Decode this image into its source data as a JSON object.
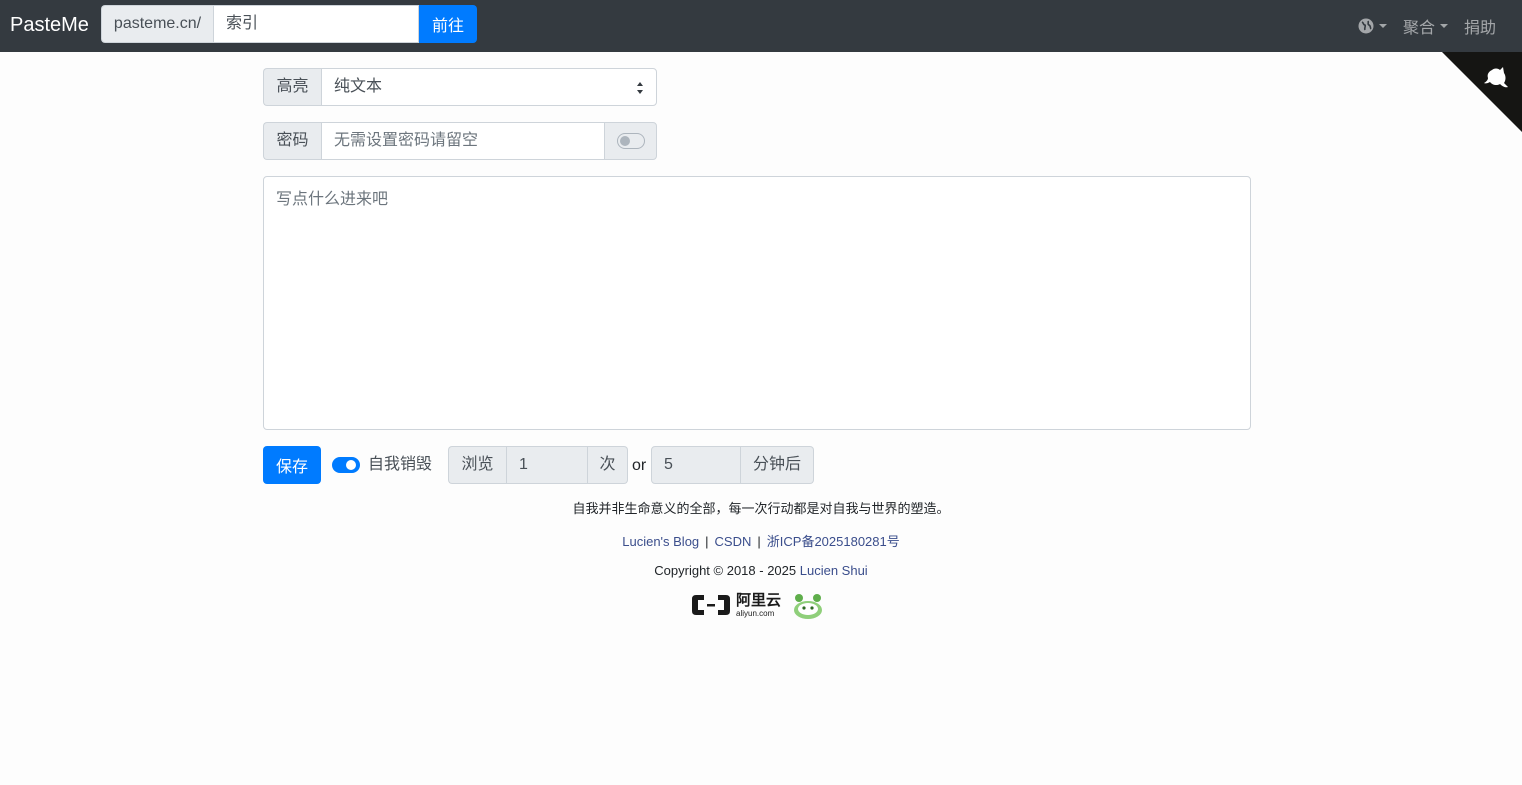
{
  "navbar": {
    "brand": "PasteMe",
    "index_prefix": "pasteme.cn/",
    "index_placeholder": "索引",
    "go_label": "前往",
    "right_items": [
      {
        "icon": "globe-icon",
        "label": ""
      },
      {
        "label": "聚合"
      },
      {
        "label": "捐助"
      }
    ]
  },
  "form": {
    "highlight_label": "高亮",
    "highlight_value": "纯文本",
    "password_label": "密码",
    "password_placeholder": "无需设置密码请留空",
    "password_toggle_on": false,
    "content_placeholder": "写点什么进来吧",
    "save_label": "保存",
    "self_destruct_label": "自我销毁",
    "self_destruct_on": true,
    "views_label": "浏览",
    "views_value": "1",
    "views_unit": "次",
    "or_label": "or",
    "minutes_value": "5",
    "minutes_unit": "分钟后"
  },
  "footer": {
    "motto": "自我并非生命意义的全部，每一次行动都是对自我与世界的塑造。",
    "links": [
      "Lucien's Blog",
      "CSDN",
      "浙ICP备2025180281号"
    ],
    "link_separator": "|",
    "copyright_prefix": "Copyright © 2018 - 2025",
    "copyright_author": "Lucien Shui",
    "aliyun_cn": "阿里云",
    "aliyun_en": "aliyun.com"
  },
  "colors": {
    "navbar_bg": "#343a40",
    "primary": "#007bff",
    "link": "#3b4e8c"
  }
}
